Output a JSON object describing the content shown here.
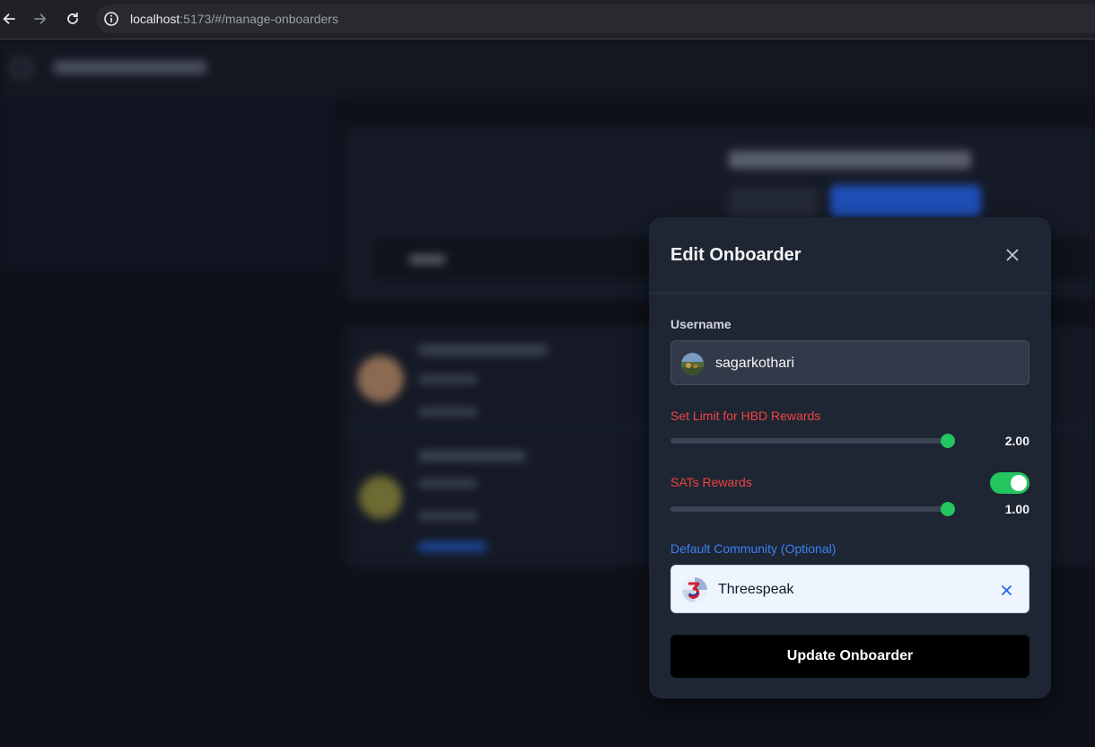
{
  "browser": {
    "url_host": "localhost",
    "url_path": ":5173/#/manage-onboarders",
    "icons": {
      "back": "arrow-left-icon",
      "forward": "arrow-right-icon",
      "reload": "reload-icon",
      "info": "info-icon"
    }
  },
  "modal": {
    "title": "Edit Onboarder",
    "close_icon": "close-icon",
    "username": {
      "label": "Username",
      "value": "sagarkothari"
    },
    "hbd": {
      "label": "Set Limit for HBD Rewards",
      "value": "2.00",
      "level_fraction": 1.0
    },
    "sats": {
      "label": "SATs Rewards",
      "enabled": true,
      "value": "1.00",
      "level_fraction": 1.0
    },
    "community": {
      "label": "Default Community (Optional)",
      "value": "Threespeak",
      "clear_icon": "close-icon"
    },
    "submit_label": "Update Onboarder"
  },
  "colors": {
    "modal_bg": "#1e2533",
    "danger_label": "#ef4444",
    "accent_blue": "#3b82f6",
    "success_green": "#22c55e",
    "submit_bg": "#000000"
  }
}
